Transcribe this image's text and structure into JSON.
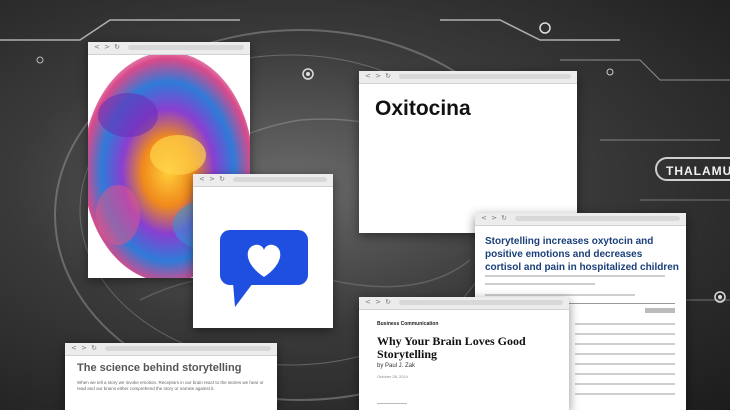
{
  "overlay_label": "THALAMU",
  "windows": {
    "chrome_dots": "< > ↻",
    "oxitocina": {
      "title": "Oxitocina"
    },
    "paper": {
      "title": "Storytelling increases oxytocin and positive emotions and decreases cortisol and pain in hospitalized children"
    },
    "hbr": {
      "kicker": "Business Communication",
      "title": "Why Your Brain Loves Good Storytelling",
      "byline": "by Paul J. Zak",
      "date": "October 28, 2014"
    },
    "science": {
      "title": "The science behind storytelling",
      "body": "When we tell a story we invoke emotion. Receptors in our brain react to the stories we hear or read and our brains either comprehend the story or narrate against it."
    }
  },
  "icons": {
    "message": "heart-message-icon",
    "explosion": "paint-explosion-image"
  },
  "colors": {
    "message_blue": "#1f4fe0",
    "paper_title": "#1a3f7a",
    "background": "#2b2b2b"
  }
}
